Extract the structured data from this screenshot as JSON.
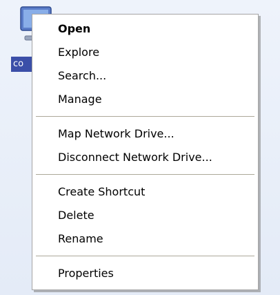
{
  "desktop": {
    "icon": "computer-icon",
    "label": "co"
  },
  "context_menu": {
    "groups": [
      [
        {
          "label": "Open",
          "bold": true
        },
        {
          "label": "Explore"
        },
        {
          "label": "Search..."
        },
        {
          "label": "Manage"
        }
      ],
      [
        {
          "label": "Map Network Drive..."
        },
        {
          "label": "Disconnect Network Drive..."
        }
      ],
      [
        {
          "label": "Create Shortcut"
        },
        {
          "label": "Delete"
        },
        {
          "label": "Rename"
        }
      ],
      [
        {
          "label": "Properties"
        }
      ]
    ]
  },
  "colors": {
    "selection_highlight": "#3b4fa8",
    "separator": "#aca899",
    "menu_background": "#ffffff"
  }
}
